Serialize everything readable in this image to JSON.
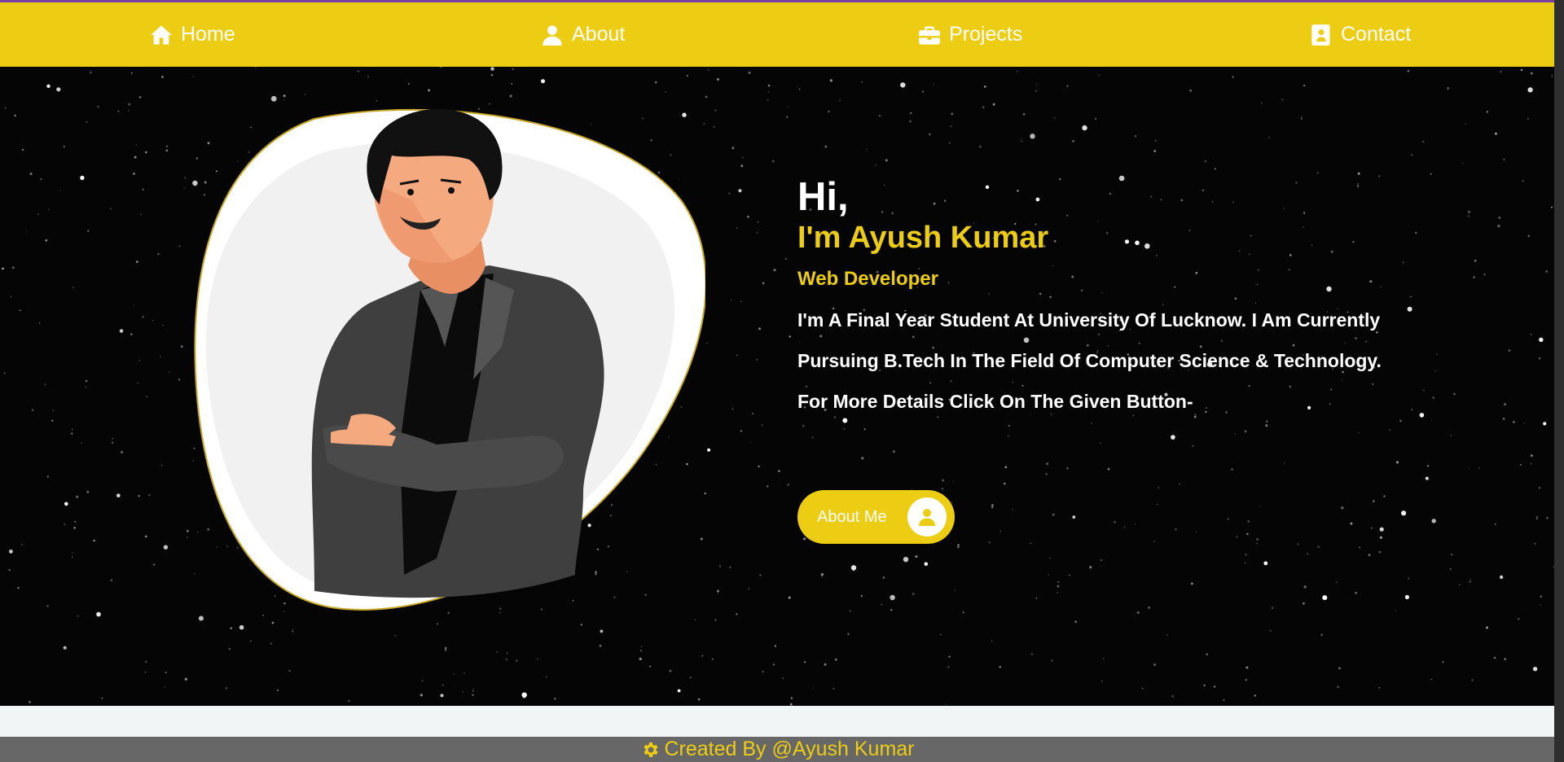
{
  "nav": {
    "items": [
      {
        "label": "Home",
        "icon": "home-icon"
      },
      {
        "label": "About",
        "icon": "user-icon"
      },
      {
        "label": "Projects",
        "icon": "briefcase-icon"
      },
      {
        "label": "Contact",
        "icon": "contact-book-icon"
      }
    ]
  },
  "hero": {
    "greeting": "Hi,",
    "name": "I'm Ayush Kumar",
    "role": "Web Developer",
    "description": "I'm A Final Year Student At University Of Lucknow. I Am Currently Pursuing B.Tech In The Field Of Computer Science & Technology.",
    "cta_text": "For More Details Click On The Given Button-",
    "button_label": "About Me",
    "button_icon": "user-icon",
    "avatar": "developer-illustration"
  },
  "footer": {
    "icon": "gear-icon",
    "text": "Created By @Ayush Kumar"
  },
  "colors": {
    "accent": "#eccd13",
    "hero_bg": "#050505",
    "footer_bg": "#676767"
  }
}
